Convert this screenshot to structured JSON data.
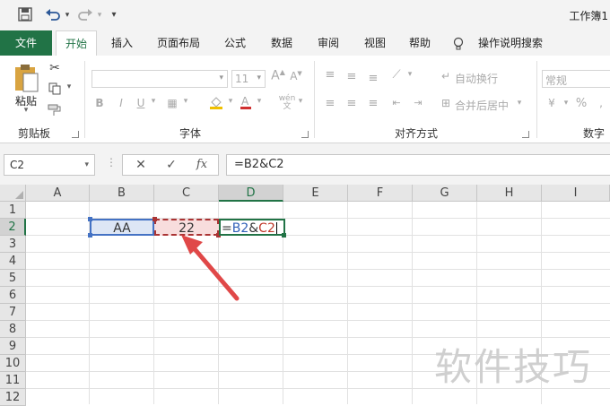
{
  "quick_access": {
    "save_icon": "save-icon",
    "undo_icon": "undo-icon",
    "redo_icon": "redo-icon",
    "customize_icon": "customize-icon"
  },
  "title": "工作簿1",
  "tabs": [
    "文件",
    "开始",
    "插入",
    "页面布局",
    "公式",
    "数据",
    "审阅",
    "视图",
    "帮助"
  ],
  "tell_me": "操作说明搜索",
  "ribbon": {
    "clipboard": {
      "paste_label": "粘贴",
      "group_label": "剪贴板"
    },
    "font": {
      "size": "11",
      "group_label": "字体"
    },
    "alignment": {
      "wrap_text": "自动换行",
      "merge_center": "合并后居中",
      "group_label": "对齐方式"
    },
    "number": {
      "format": "常规",
      "percent": "%",
      "group_label": "数字"
    }
  },
  "formula_bar": {
    "name_box": "C2",
    "cancel": "✕",
    "enter": "✓",
    "fx": "fx",
    "formula": "=B2&C2"
  },
  "sheet": {
    "columns": [
      "A",
      "B",
      "C",
      "D",
      "E",
      "F",
      "G",
      "H",
      "I"
    ],
    "rows": [
      "1",
      "2",
      "3",
      "4",
      "5",
      "6",
      "7",
      "8",
      "9",
      "10",
      "11",
      "12"
    ],
    "B2": "AA",
    "C2": "22",
    "D2_parts": {
      "eq": "=",
      "ref1": "B2",
      "amp": "&",
      "ref2": "C2"
    }
  },
  "watermark": "软件技巧",
  "colors": {
    "accent": "#217346",
    "ref_blue": "#4472c4",
    "ref_red": "#a33333",
    "arrow": "#e04848"
  }
}
